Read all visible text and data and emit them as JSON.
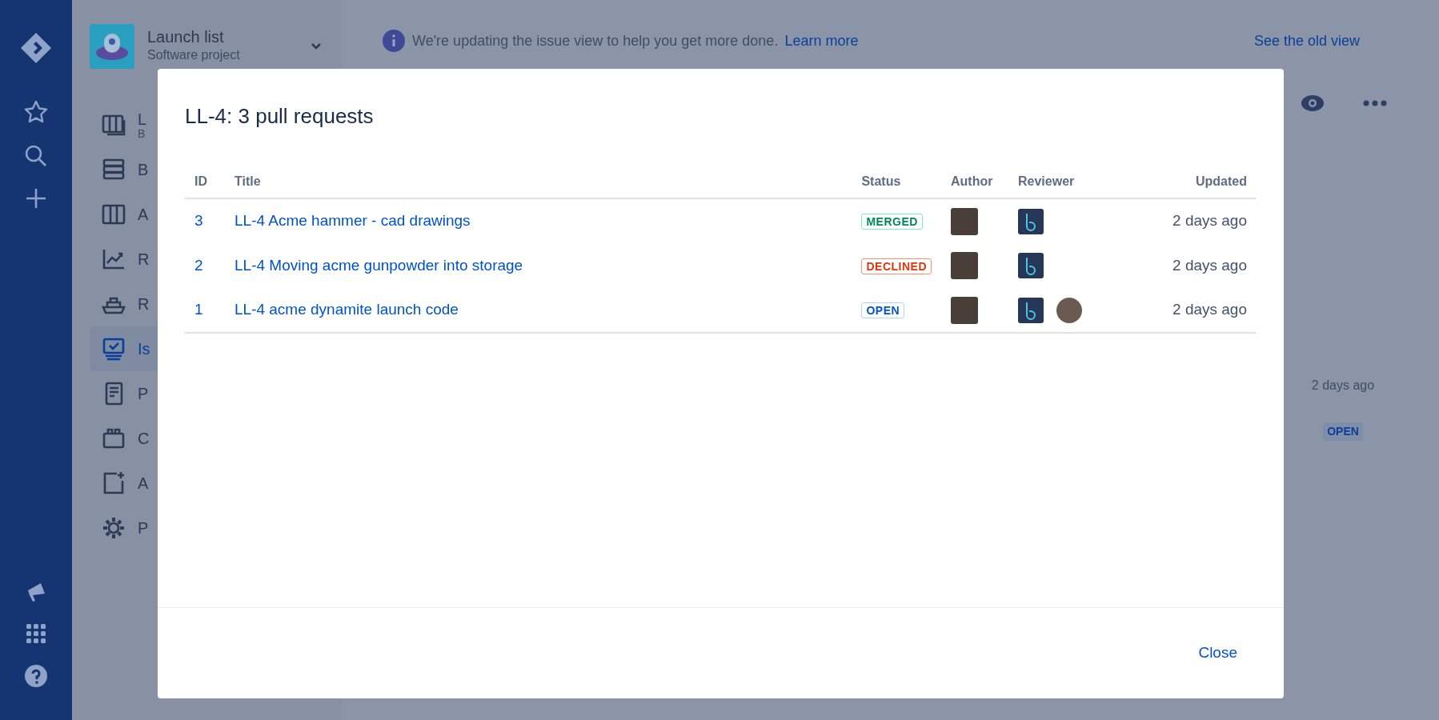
{
  "project": {
    "name": "Launch list",
    "type": "Software project"
  },
  "sidebar": {
    "items": [
      {
        "label": "L",
        "sublabel": "B",
        "selected": false
      },
      {
        "label": "B",
        "selected": false
      },
      {
        "label": "A",
        "selected": false
      },
      {
        "label": "R",
        "selected": false
      },
      {
        "label": "R",
        "selected": false
      },
      {
        "label": "Is",
        "selected": true
      },
      {
        "label": "P",
        "selected": false
      },
      {
        "label": "C",
        "selected": false
      },
      {
        "label": "A",
        "selected": false
      },
      {
        "label": "P",
        "selected": false
      }
    ]
  },
  "banner": {
    "message": "We're updating the issue view to help you get more done.",
    "link": "Learn more",
    "old_view_link": "See the old view"
  },
  "background_issue": {
    "updated": "2 days ago",
    "status": "OPEN"
  },
  "dialog": {
    "title": "LL-4: 3 pull requests",
    "table": {
      "columns": [
        "ID",
        "Title",
        "Status",
        "Author",
        "Reviewer",
        "Updated"
      ],
      "rows": [
        {
          "id": "3",
          "title": "LL-4 Acme hammer - cad drawings",
          "status": "MERGED",
          "kind": "merged",
          "reviewers": [
            {
              "kind": "app"
            }
          ],
          "updated": "2 days ago"
        },
        {
          "id": "2",
          "title": "LL-4 Moving acme gunpowder into storage",
          "status": "DECLINED",
          "kind": "declined",
          "reviewers": [
            {
              "kind": "app"
            }
          ],
          "updated": "2 days ago"
        },
        {
          "id": "1",
          "title": "LL-4 acme dynamite launch code",
          "status": "OPEN",
          "kind": "open",
          "reviewers": [
            {
              "kind": "app"
            },
            {
              "kind": "person"
            }
          ],
          "updated": "2 days ago"
        }
      ]
    },
    "close": "Close"
  }
}
